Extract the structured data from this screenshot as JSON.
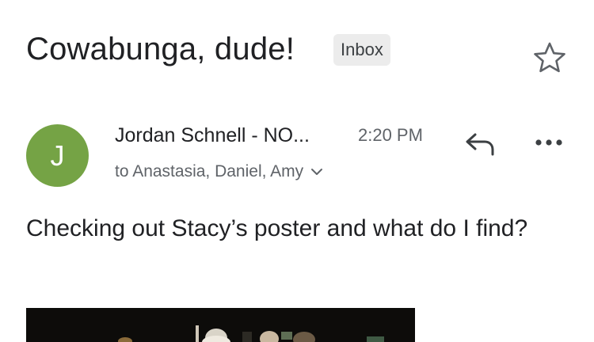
{
  "email": {
    "subject": "Cowabunga, dude!",
    "label": "Inbox",
    "sender": {
      "initial": "J",
      "name": "Jordan Schnell - NO...",
      "avatar_color": "#75a345"
    },
    "time": "2:20 PM",
    "recipients": "to Anastasia, Daniel, Amy",
    "body": "Checking out Stacy’s poster and what do I find?"
  },
  "icons": {
    "star": "star-outline-icon",
    "reply": "reply-arrow-icon",
    "more": "more-horizontal-icon",
    "expand": "chevron-down-icon"
  },
  "colors": {
    "text_primary": "#202124",
    "text_secondary": "#5f6368",
    "chip_bg": "#ececec"
  }
}
